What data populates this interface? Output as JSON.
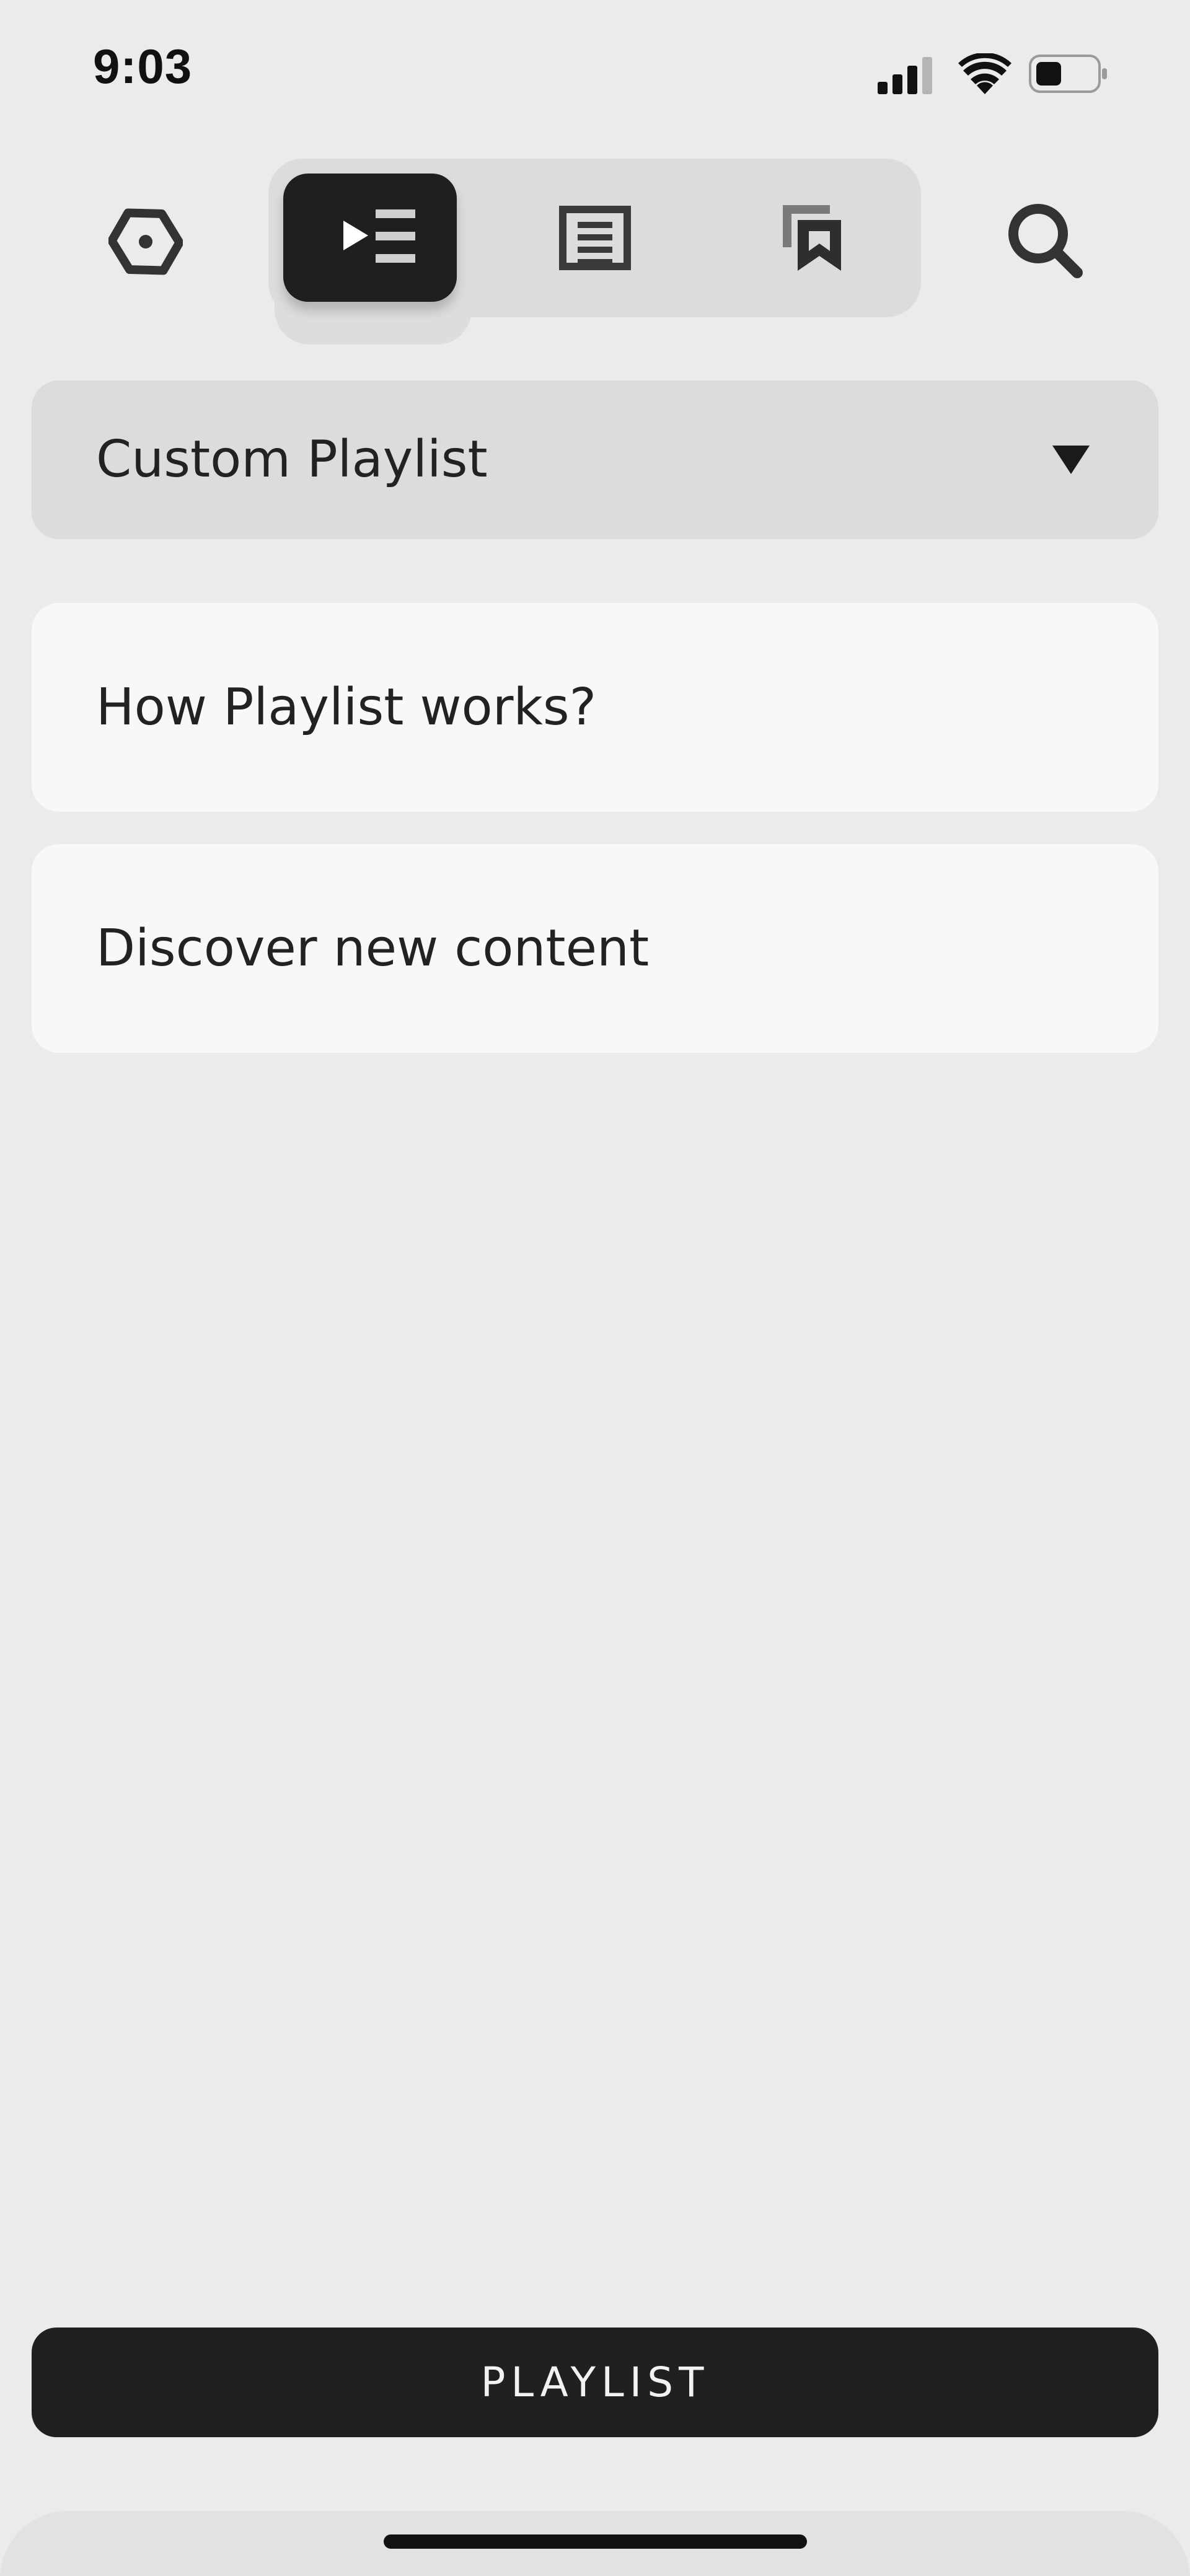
{
  "status_bar": {
    "time": "9:03"
  },
  "nav": {
    "tabs": [
      {
        "id": "playlist",
        "icon": "play-list-icon",
        "active": true
      },
      {
        "id": "articles",
        "icon": "document-icon",
        "active": false
      },
      {
        "id": "bookmarks",
        "icon": "bookmark-icon",
        "active": false
      }
    ],
    "settings_icon": "hexagon-settings-icon",
    "search_icon": "search-icon"
  },
  "dropdown": {
    "selected": "Custom Playlist",
    "icon": "caret-down-icon"
  },
  "cards": [
    {
      "label": "How Playlist works?"
    },
    {
      "label": "Discover new content"
    }
  ],
  "bottom_button": {
    "label": "PLAYLIST"
  },
  "colors": {
    "background": "#ebebeb",
    "card": "#f8f8f8",
    "segmented_bg": "#dcdcdc",
    "active": "#1f1f1f",
    "text": "#222222"
  }
}
